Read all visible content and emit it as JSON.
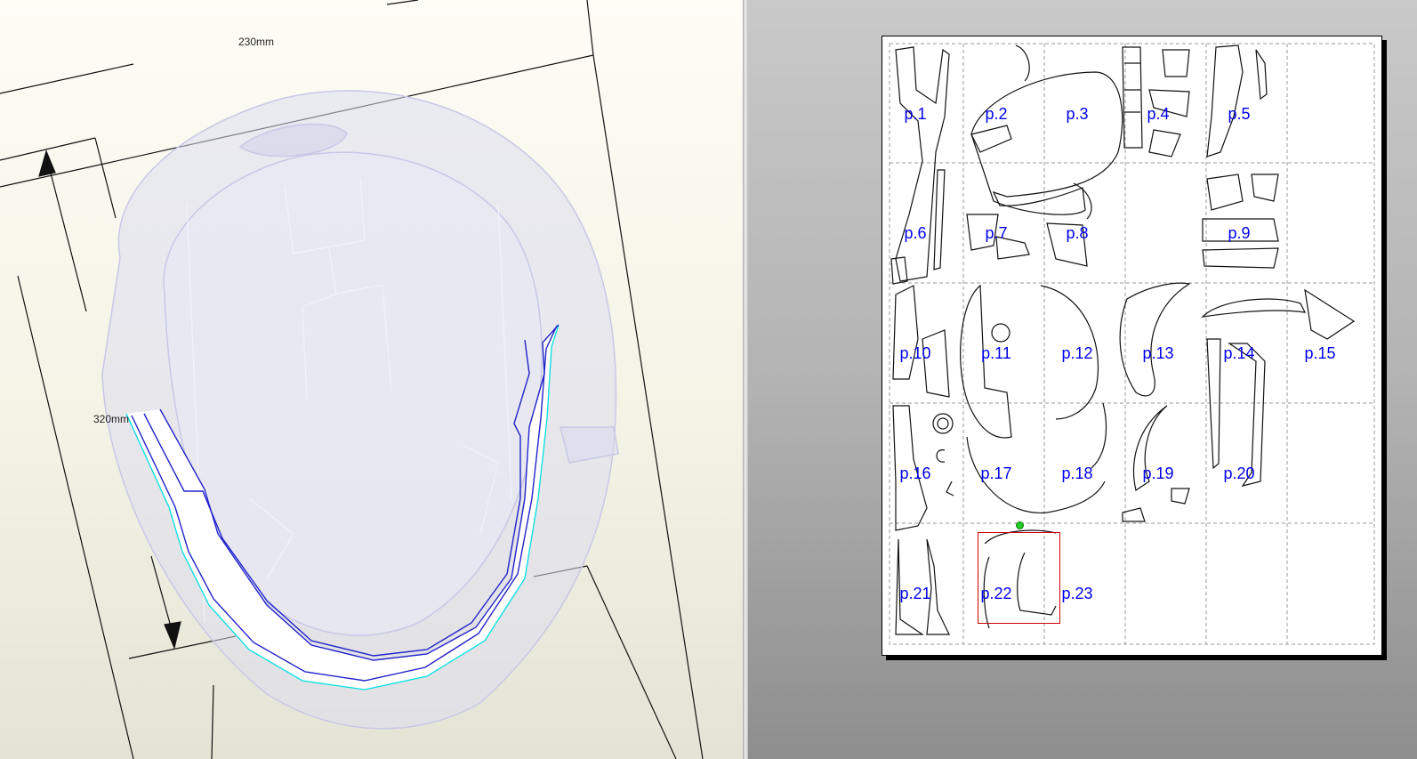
{
  "dimensions": {
    "width_label": "230mm",
    "height_label": "320mm"
  },
  "layout_sheet": {
    "pages": [
      "p.1",
      "p.2",
      "p.3",
      "p.4",
      "p.5",
      "p.6",
      "p.7",
      "p.8",
      "p.9",
      "p.10",
      "p.11",
      "p.12",
      "p.13",
      "p.14",
      "p.15",
      "p.16",
      "p.17",
      "p.18",
      "p.19",
      "p.20",
      "p.21",
      "p.22",
      "p.23"
    ]
  },
  "colors": {
    "page_label": "#0000ee",
    "selected_part_outline": "#2222cc",
    "selected_part_edge": "#00e0e0",
    "selection_box": "#cc0000",
    "rotate_handle": "#22cc22"
  }
}
